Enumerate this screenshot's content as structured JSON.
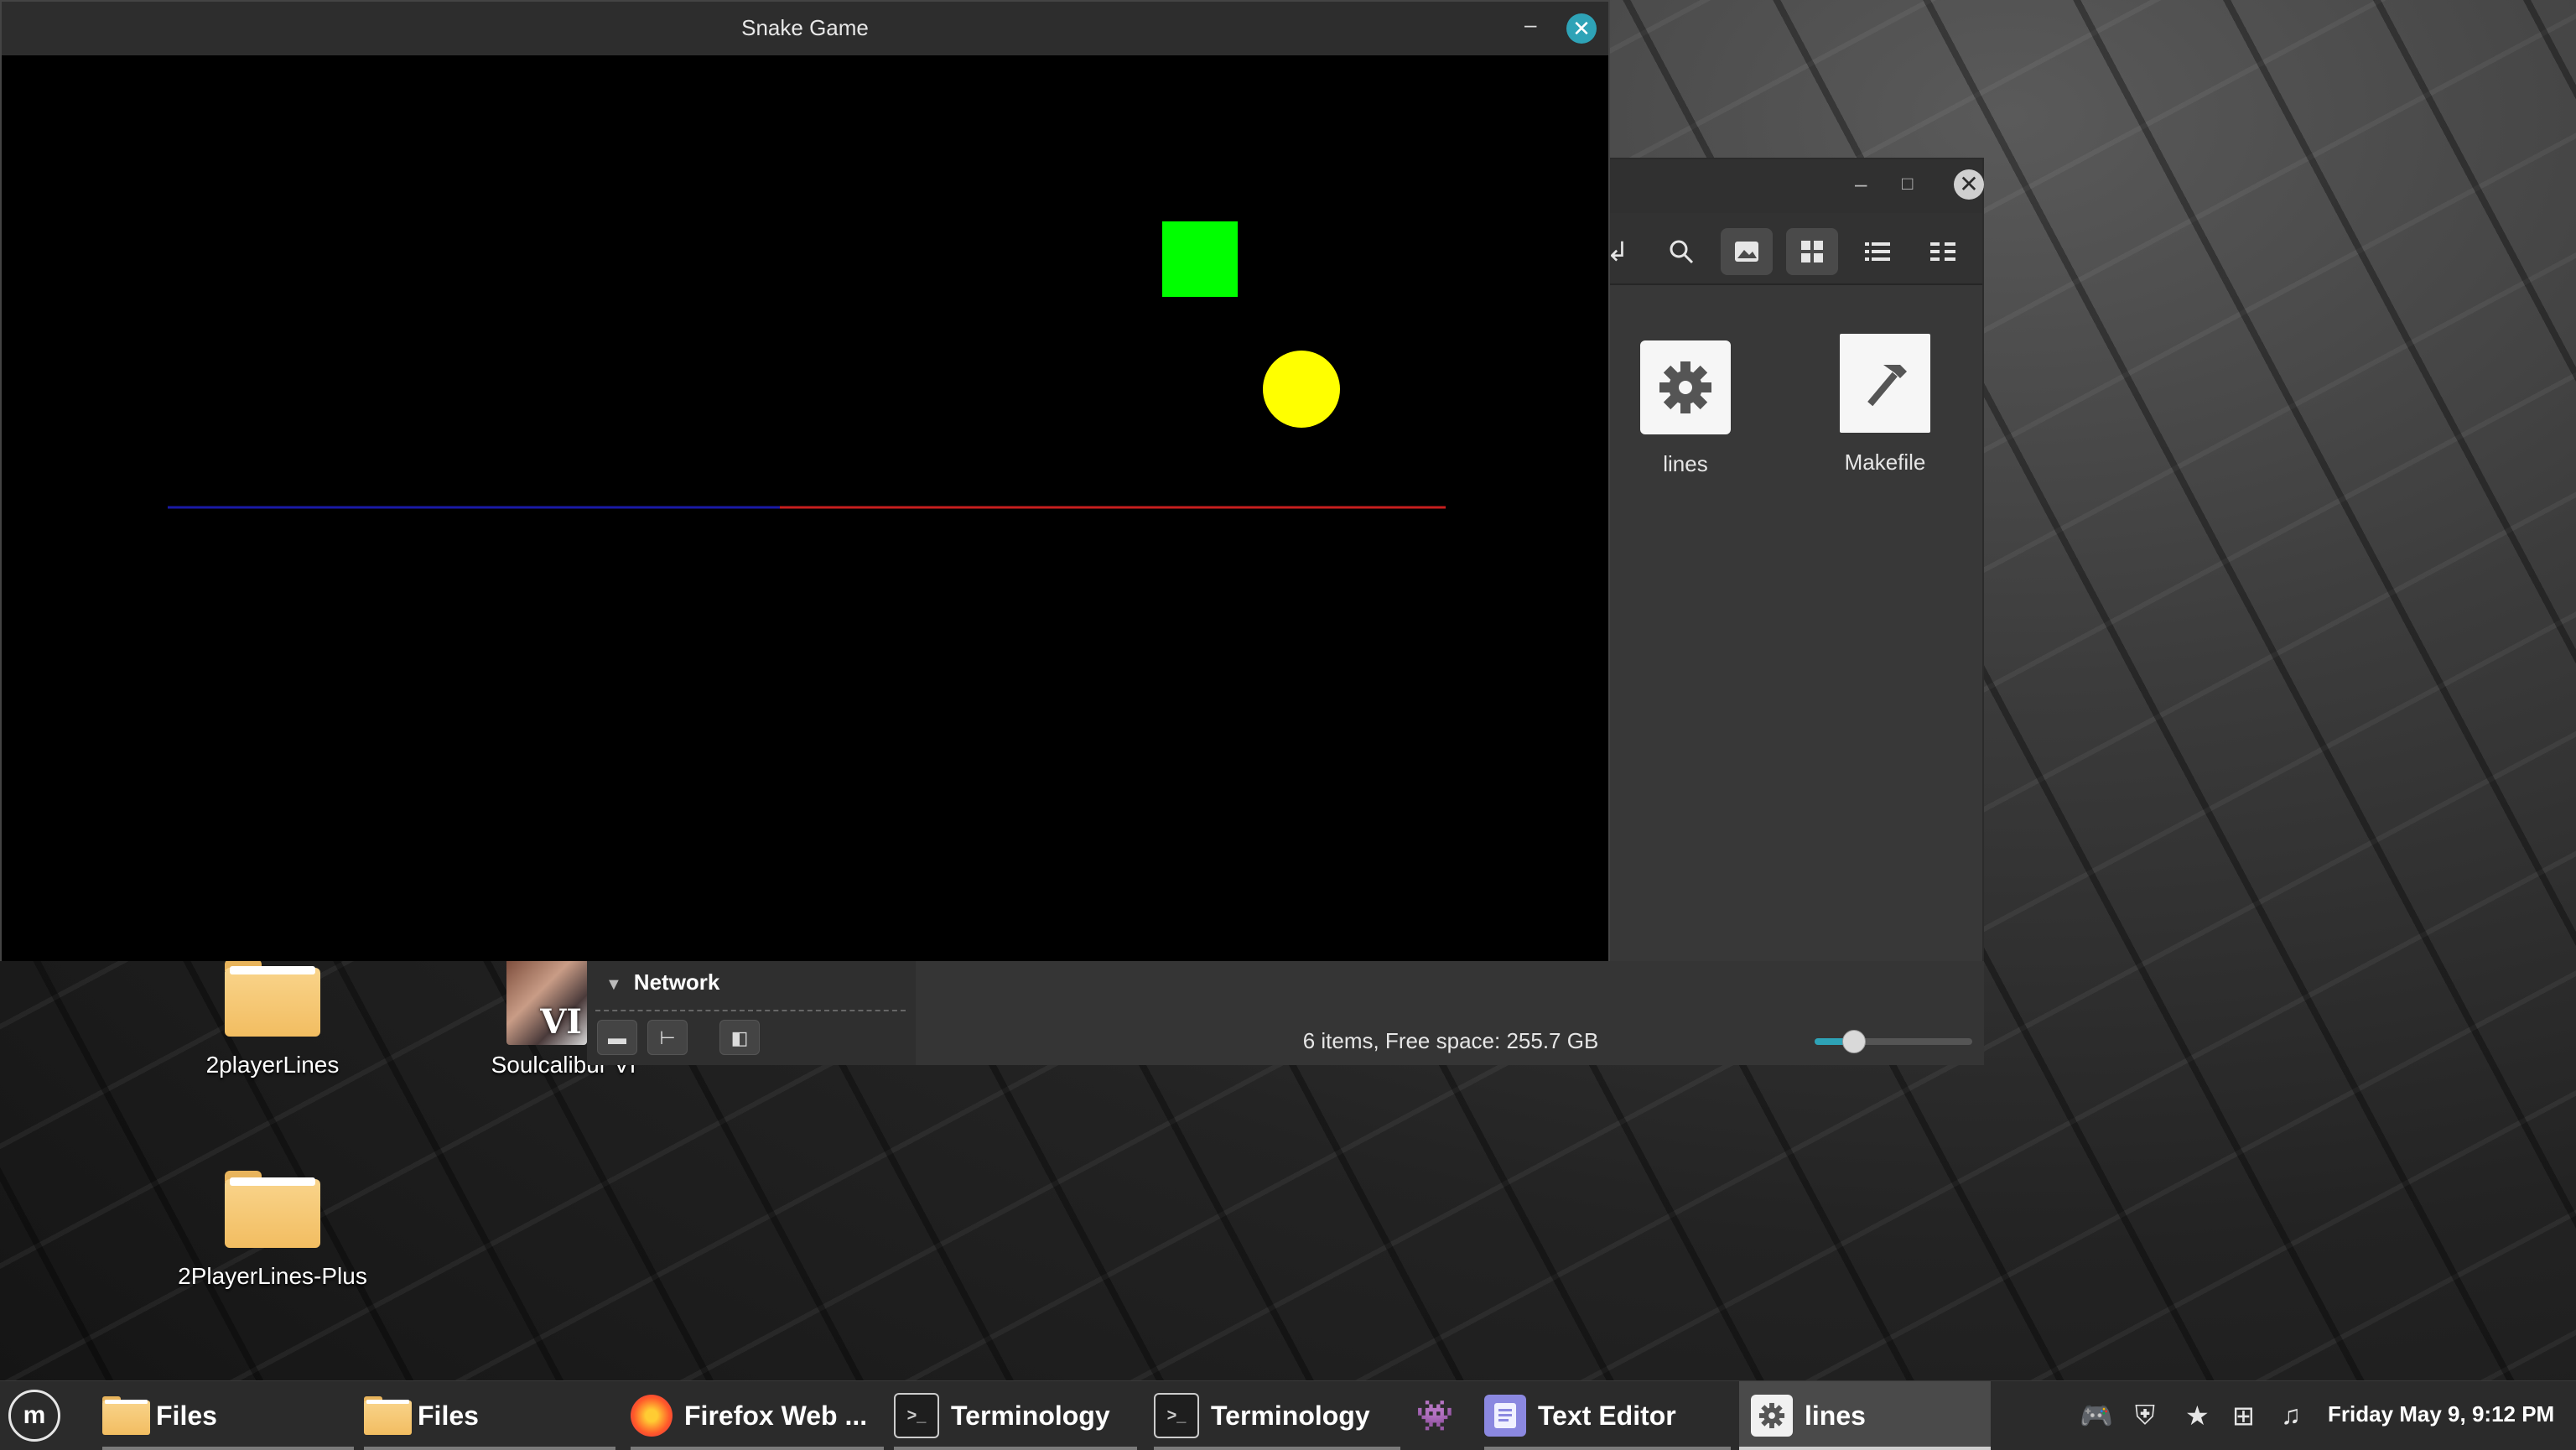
{
  "desktop": {
    "icons": [
      {
        "label": "2playerLines"
      },
      {
        "label": "2PlayerLines-Plus"
      },
      {
        "label": "Soulcalibur VI",
        "visible_label": "Soulcalibur VI"
      }
    ]
  },
  "snake_window": {
    "title": "Snake Game",
    "minimize_glyph": "–",
    "close_glyph": "✕",
    "colors": {
      "background": "#000000",
      "food": "#00ff00",
      "player": "#ffff00",
      "trail_blue": "#1a1aa6",
      "trail_red": "#c81e1e"
    }
  },
  "file_manager": {
    "files": [
      {
        "label": "lines",
        "icon": "gear-icon"
      },
      {
        "label": "Makefile",
        "icon": "hammer-icon"
      }
    ],
    "sidebar": {
      "network_label": "Network"
    },
    "status": "6 items, Free space: 255.7 GB",
    "zoom_level": 0.25,
    "toolbar": [
      "back-icon",
      "search-icon",
      "image-icon",
      "grid-view-icon",
      "list-view-icon",
      "compact-view-icon"
    ]
  },
  "taskbar": {
    "items": [
      {
        "label": "Files",
        "icon": "folder-icon"
      },
      {
        "label": "Files",
        "icon": "folder-icon"
      },
      {
        "label": "Firefox Web ...",
        "icon": "firefox-icon"
      },
      {
        "label": "Terminology",
        "icon": "terminal-icon"
      },
      {
        "label": "Terminology",
        "icon": "terminal-icon"
      },
      {
        "label": "",
        "icon": "game-controller-icon"
      },
      {
        "label": "Text Editor",
        "icon": "text-editor-icon"
      },
      {
        "label": "lines",
        "icon": "gear-icon"
      }
    ],
    "clock": "Friday May 9, 9:12 PM",
    "tray": [
      "discord-icon",
      "shield-icon",
      "star-icon",
      "network-icon",
      "music-icon"
    ]
  }
}
